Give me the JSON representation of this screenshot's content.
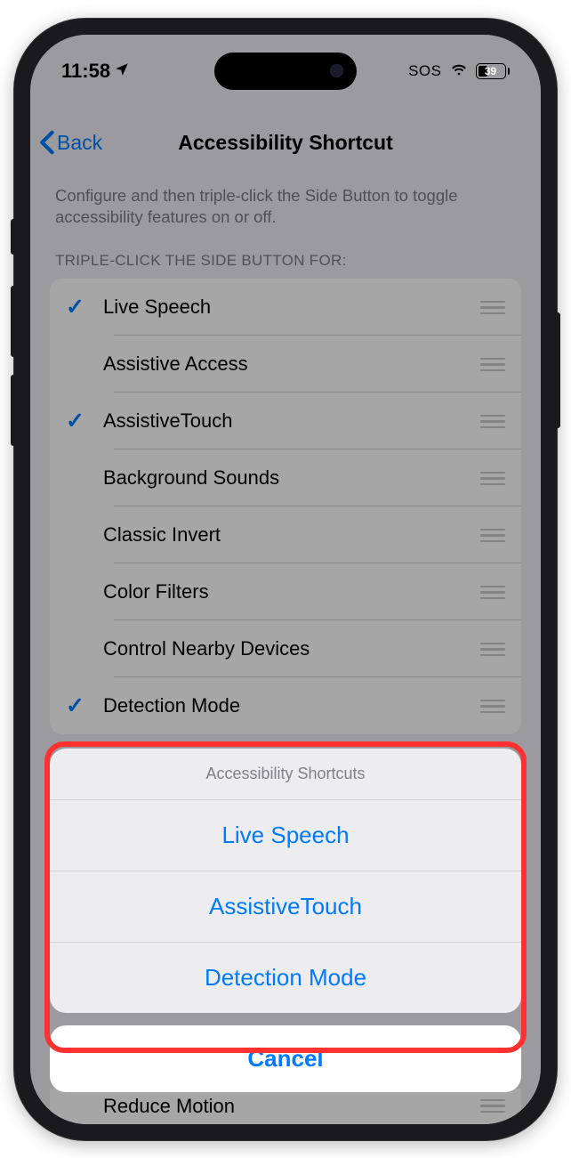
{
  "status": {
    "time": "11:58",
    "sos": "SOS",
    "battery": "39"
  },
  "nav": {
    "back": "Back",
    "title": "Accessibility Shortcut"
  },
  "page": {
    "description": "Configure and then triple-click the Side Button to toggle accessibility features on or off.",
    "section_header": "TRIPLE-CLICK THE SIDE BUTTON FOR:"
  },
  "items": [
    {
      "label": "Live Speech",
      "checked": true
    },
    {
      "label": "Assistive Access",
      "checked": false
    },
    {
      "label": "AssistiveTouch",
      "checked": true
    },
    {
      "label": "Background Sounds",
      "checked": false
    },
    {
      "label": "Classic Invert",
      "checked": false
    },
    {
      "label": "Color Filters",
      "checked": false
    },
    {
      "label": "Control Nearby Devices",
      "checked": false
    },
    {
      "label": "Detection Mode",
      "checked": true
    }
  ],
  "peek": {
    "label": "Reduce Motion"
  },
  "sheet": {
    "title": "Accessibility Shortcuts",
    "options": [
      "Live Speech",
      "AssistiveTouch",
      "Detection Mode"
    ],
    "cancel": "Cancel"
  }
}
